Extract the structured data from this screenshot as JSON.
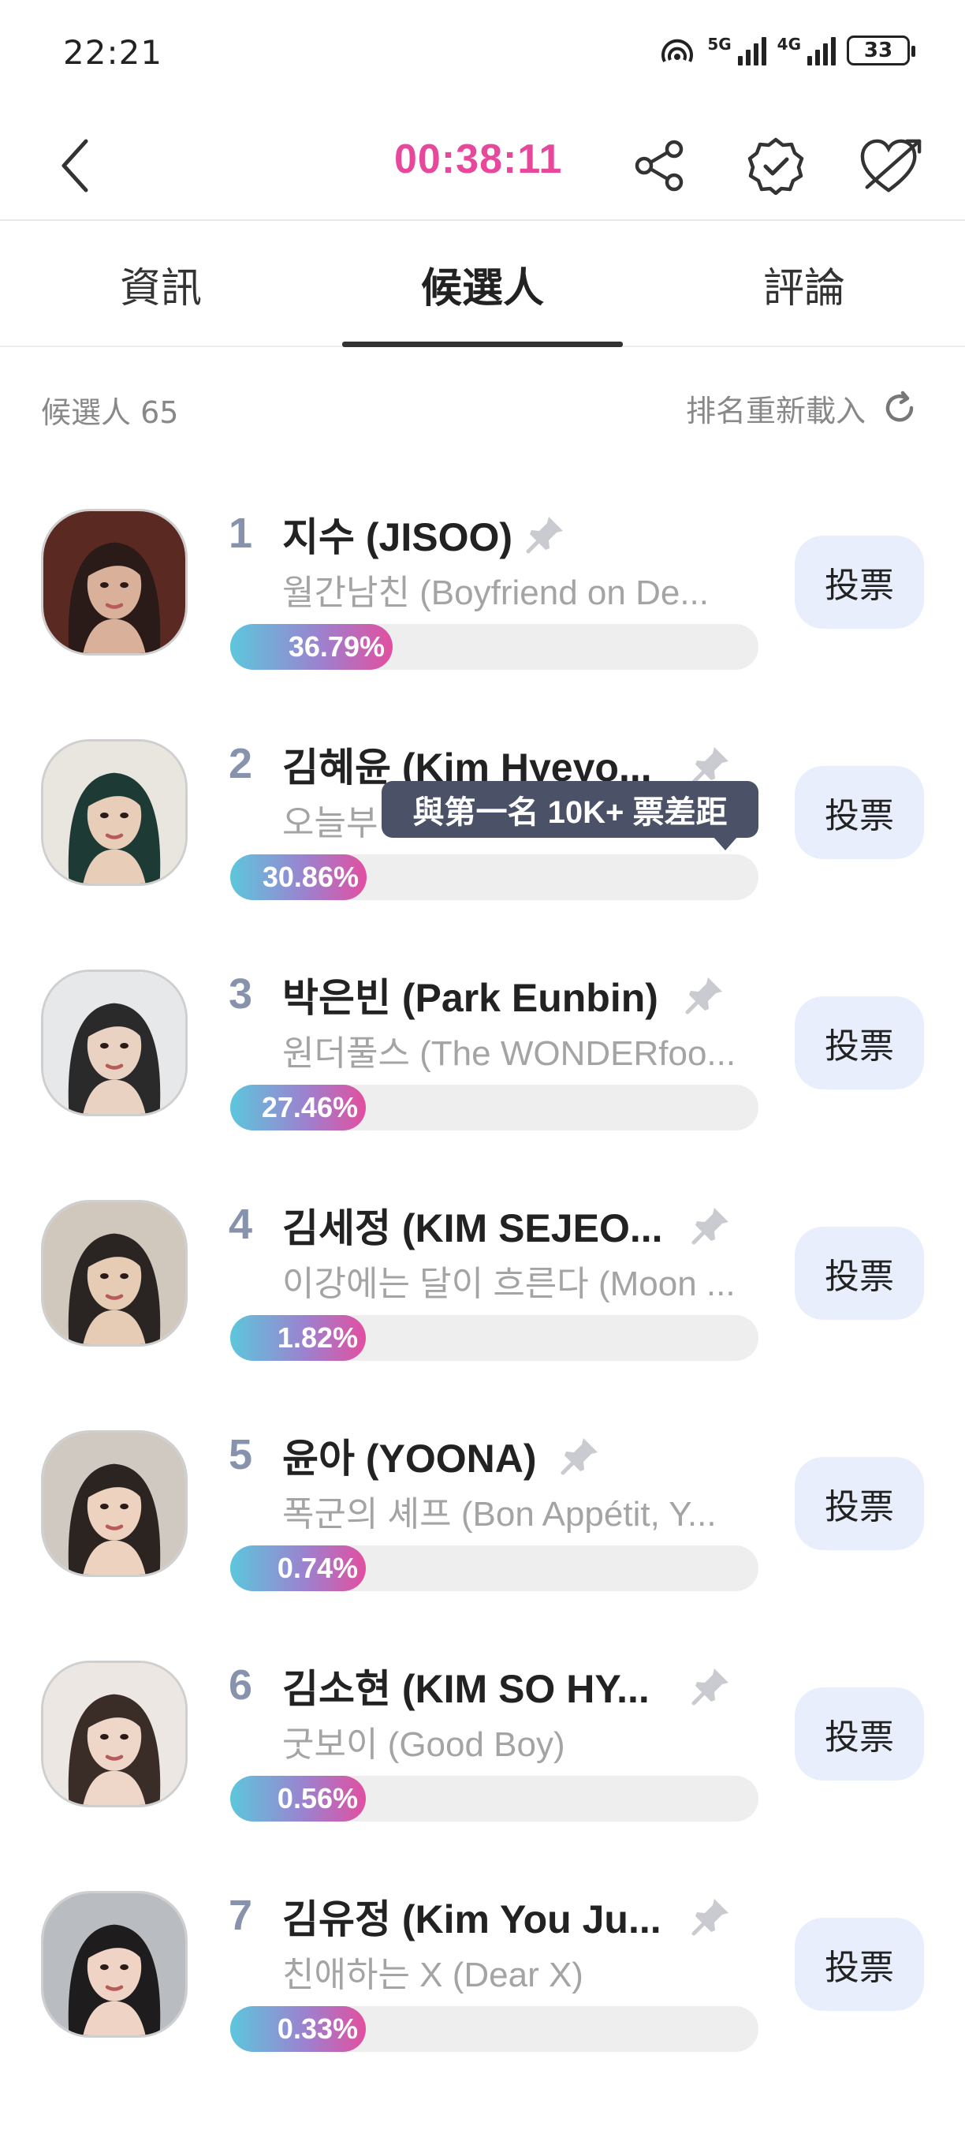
{
  "status_bar": {
    "time": "22:21",
    "network_5g": "5G",
    "network_4g": "4G",
    "battery": "33"
  },
  "header": {
    "timer": "00:38:11",
    "icons": [
      "back-arrow-icon",
      "share-icon",
      "verified-badge-icon",
      "heart-arrow-icon"
    ]
  },
  "tabs": [
    {
      "label": "資訊",
      "active": false
    },
    {
      "label": "候選人",
      "active": true
    },
    {
      "label": "評論",
      "active": false
    }
  ],
  "subbar": {
    "count_label": "候選人 65",
    "reload_label": "排名重新載入"
  },
  "tooltip": "與第一名 10K+ 票差距",
  "vote_label": "投票",
  "candidates": [
    {
      "rank": "1",
      "name": "지수 (JISOO)",
      "work": "월간남친 (Boyfriend on De...",
      "percent": "36.79%",
      "fill": 0.3679
    },
    {
      "rank": "2",
      "name": "김혜윤 (Kim Hyeyo...",
      "work": "오늘부",
      "percent": "30.86%",
      "fill": 0.3086
    },
    {
      "rank": "3",
      "name": "박은빈 (Park Eunbin)",
      "work": "원더풀스 (The WONDERfoo...",
      "percent": "27.46%",
      "fill": 0.2746
    },
    {
      "rank": "4",
      "name": "김세정 (KIM SEJEO...",
      "work": "이강에는 달이 흐른다 (Moon ...",
      "percent": "1.82%",
      "fill": 0.0182
    },
    {
      "rank": "5",
      "name": "윤아 (YOONA)",
      "work": "폭군의 셰프 (Bon Appétit, Y...",
      "percent": "0.74%",
      "fill": 0.0074
    },
    {
      "rank": "6",
      "name": "김소현 (KIM SO HY...",
      "work": "굿보이 (Good Boy)",
      "percent": "0.56%",
      "fill": 0.0056
    },
    {
      "rank": "7",
      "name": "김유정 (Kim You Ju...",
      "work": "친애하는 X (Dear X)",
      "percent": "0.33%",
      "fill": 0.0033
    }
  ],
  "colors": {
    "timer": "#e8489b",
    "rank": "#8793ad",
    "vote_button_bg": "#e8eefb",
    "tooltip_bg": "#4b5268"
  }
}
